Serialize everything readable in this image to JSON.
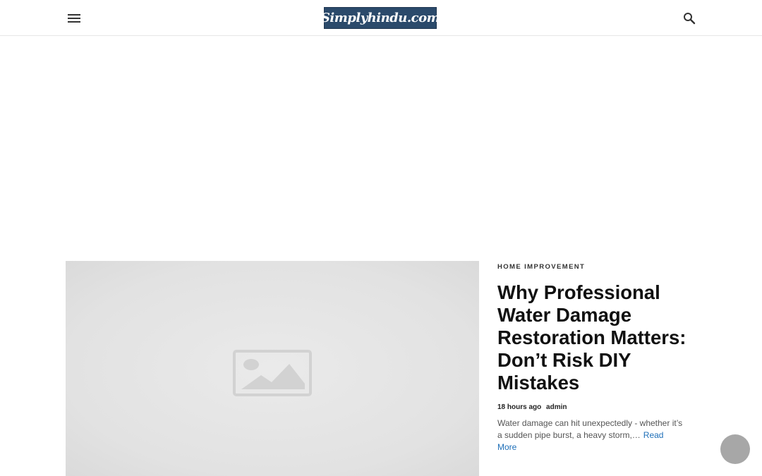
{
  "header": {
    "logo_text": "Simplyhindu.com",
    "menu_icon": "hamburger-menu-icon",
    "search_icon": "search-icon"
  },
  "featured_post": {
    "category": "HOME IMPROVEMENT",
    "title": "Why Professional Water Damage Restoration Matters: Don’t Risk DIY Mistakes",
    "time_ago": "18 hours ago",
    "author": "admin",
    "excerpt": "Water damage can hit unexpectedly - whether it’s a sudden pipe burst, a heavy storm,…",
    "read_more_label": "Read More",
    "image_icon": "image-placeholder-icon"
  },
  "floating_button": {
    "icon": "circle-button"
  },
  "colors": {
    "logo_bg": "#2b4a6b",
    "link": "#1e6fb8",
    "placeholder_bg": "#e2e2e2",
    "float_button": "#a7a7a7"
  }
}
